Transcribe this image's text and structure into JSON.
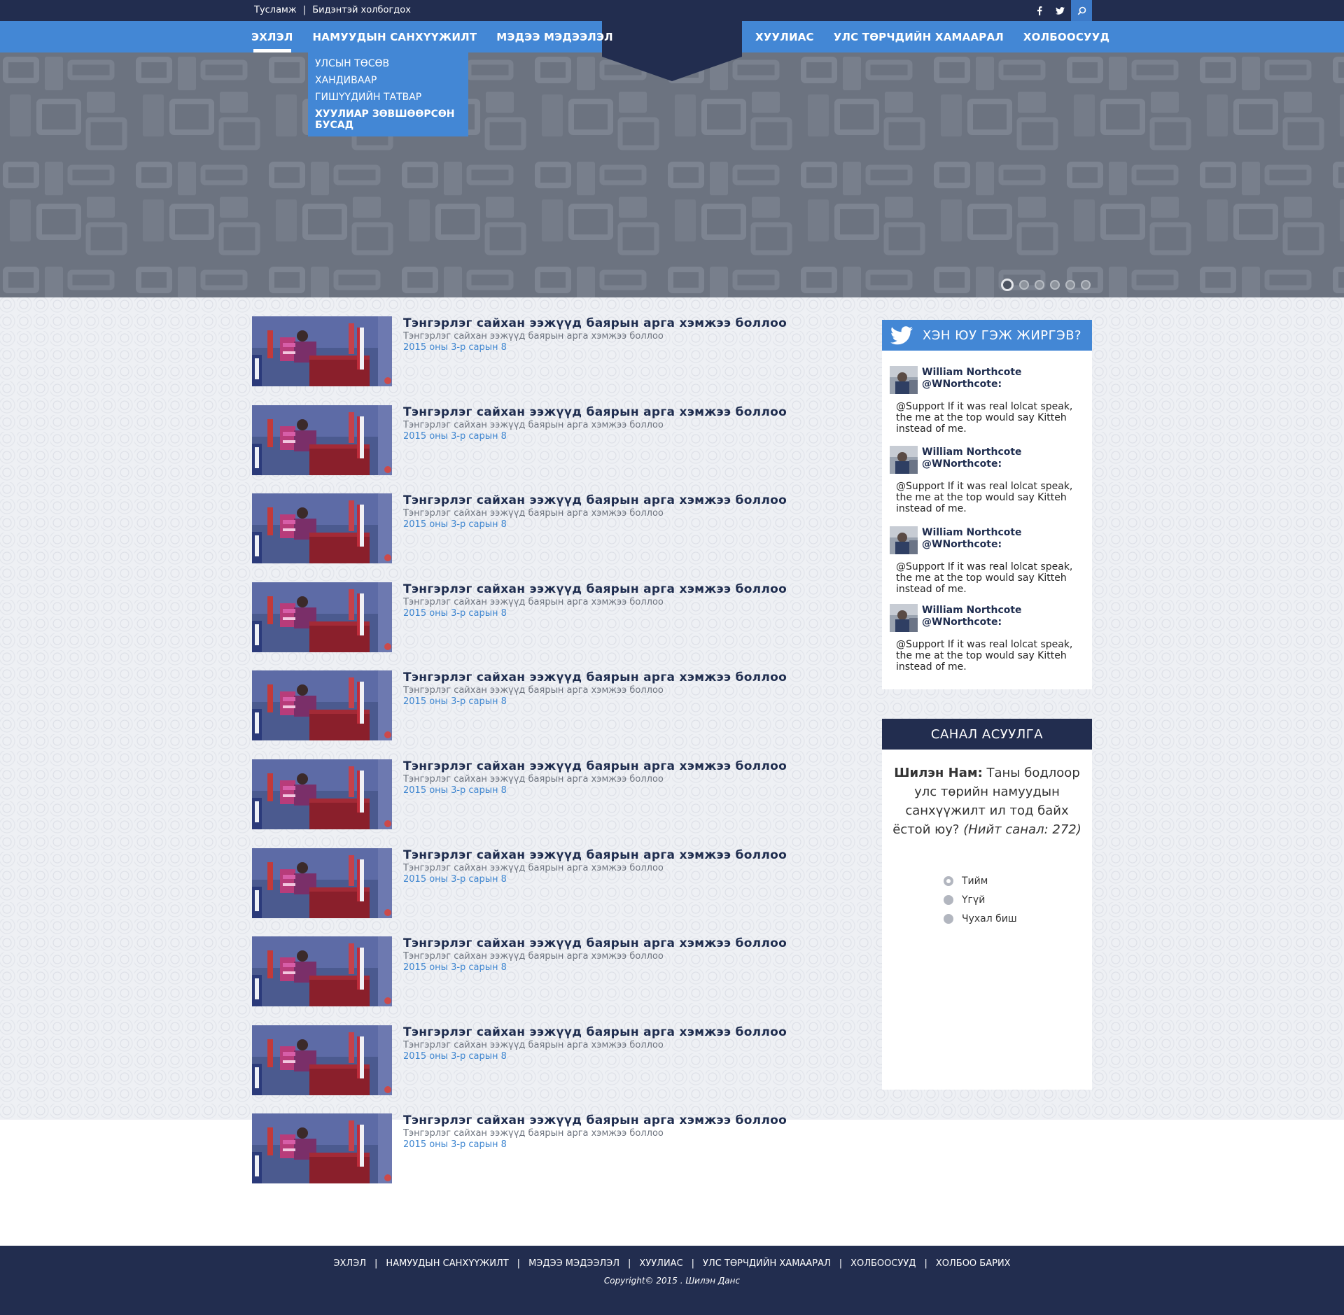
{
  "topbar": {
    "help": "Тусламж",
    "separator": "|",
    "contact": "Бидэнтэй холбогдох",
    "social": [
      "facebook-icon",
      "twitter-icon",
      "search-icon"
    ]
  },
  "nav": {
    "left": [
      "ЭХЛЭЛ",
      "НАМУУДЫН САНХҮҮЖИЛТ",
      "МЭДЭЭ МЭДЭЭЛЭЛ"
    ],
    "right": [
      "ХУУЛИАС",
      "УЛС ТӨРЧДИЙН ХАМААРАЛ",
      "ХОЛБООСУУД"
    ],
    "active_index": 0
  },
  "dropdown": [
    "УЛСЫН ТӨСӨВ",
    "ХАНДИВААР",
    "ГИШҮҮДИЙН ТАТВАР",
    "ХУУЛИАР ЗӨВШӨӨРСӨН БУСАД"
  ],
  "slider": {
    "count": 6,
    "active": 0
  },
  "news": [
    {
      "title": "Тэнгэрлэг сайхан ээжүүд баярын арга хэмжээ боллоо",
      "subtitle": "Тэнгэрлэг сайхан ээжүүд баярын арга хэмжээ боллоо",
      "date": "2015 оны 3-р сарын 8"
    },
    {
      "title": "Тэнгэрлэг сайхан ээжүүд баярын арга хэмжээ боллоо",
      "subtitle": "Тэнгэрлэг сайхан ээжүүд баярын арга хэмжээ боллоо",
      "date": "2015 оны 3-р сарын 8"
    },
    {
      "title": "Тэнгэрлэг сайхан ээжүүд баярын арга хэмжээ боллоо",
      "subtitle": "Тэнгэрлэг сайхан ээжүүд баярын арга хэмжээ боллоо",
      "date": "2015 оны 3-р сарын 8"
    },
    {
      "title": "Тэнгэрлэг сайхан ээжүүд баярын арга хэмжээ боллоо",
      "subtitle": "Тэнгэрлэг сайхан ээжүүд баярын арга хэмжээ боллоо",
      "date": "2015 оны 3-р сарын 8"
    },
    {
      "title": "Тэнгэрлэг сайхан ээжүүд баярын арга хэмжээ боллоо",
      "subtitle": "Тэнгэрлэг сайхан ээжүүд баярын арга хэмжээ боллоо",
      "date": "2015 оны 3-р сарын 8"
    },
    {
      "title": "Тэнгэрлэг сайхан ээжүүд баярын арга хэмжээ боллоо",
      "subtitle": "Тэнгэрлэг сайхан ээжүүд баярын арга хэмжээ боллоо",
      "date": "2015 оны 3-р сарын 8"
    },
    {
      "title": "Тэнгэрлэг сайхан ээжүүд баярын арга хэмжээ боллоо",
      "subtitle": "Тэнгэрлэг сайхан ээжүүд баярын арга хэмжээ боллоо",
      "date": "2015 оны 3-р сарын 8"
    },
    {
      "title": "Тэнгэрлэг сайхан ээжүүд баярын арга хэмжээ боллоо",
      "subtitle": "Тэнгэрлэг сайхан ээжүүд баярын арга хэмжээ боллоо",
      "date": "2015 оны 3-р сарын 8"
    },
    {
      "title": "Тэнгэрлэг сайхан ээжүүд баярын арга хэмжээ боллоо",
      "subtitle": "Тэнгэрлэг сайхан ээжүүд баярын арга хэмжээ боллоо",
      "date": "2015 оны 3-р сарын 8"
    },
    {
      "title": "Тэнгэрлэг сайхан ээжүүд баярын арга хэмжээ боллоо",
      "subtitle": "Тэнгэрлэг сайхан ээжүүд баярын арга хэмжээ боллоо",
      "date": "2015 оны 3-р сарын 8"
    }
  ],
  "twitter": {
    "title": "ХЭН ЮУ ГЭЖ ЖИРГЭВ?",
    "tweets": [
      {
        "name": "William Northcote",
        "handle": "@WNorthcote:",
        "text": "@Support If it was real lolcat speak, the me at the top would say Kitteh instead of me."
      },
      {
        "name": "William Northcote",
        "handle": "@WNorthcote:",
        "text": "@Support If it was real lolcat speak, the me at the top would say Kitteh instead of me."
      },
      {
        "name": "William Northcote",
        "handle": "@WNorthcote:",
        "text": "@Support If it was real lolcat speak, the me at the top would say Kitteh instead of me."
      },
      {
        "name": "William Northcote",
        "handle": "@WNorthcote:",
        "text": "@Support If it was real lolcat speak, the me at the top would say Kitteh instead of me."
      }
    ]
  },
  "poll": {
    "title": "САНАЛ АСУУЛГА",
    "party": "Шилэн Нам:",
    "question": "Таны бодлоор улс төрийн намуудын санхүүжилт ил тод байх ёстой юу?",
    "total": "(Нийт санал: 272)",
    "options": [
      "Тийм",
      "Үгүй",
      "Чухал биш"
    ]
  },
  "footer": {
    "links": [
      "ЭХЛЭЛ",
      "НАМУУДЫН САНХҮҮЖИЛТ",
      "МЭДЭЭ МЭДЭЭЛЭЛ",
      "ХУУЛИАС",
      "УЛС ТӨРЧДИЙН ХАМААРАЛ",
      "ХОЛБООСУУД",
      "ХОЛБОО БАРИХ"
    ],
    "separator": "|",
    "copyright": "Copyright© 2015 . Шилэн Данс"
  },
  "colors": {
    "navy": "#222d4f",
    "blue": "#4387d5",
    "hero": "#6c7380",
    "link": "#3f86d0"
  }
}
